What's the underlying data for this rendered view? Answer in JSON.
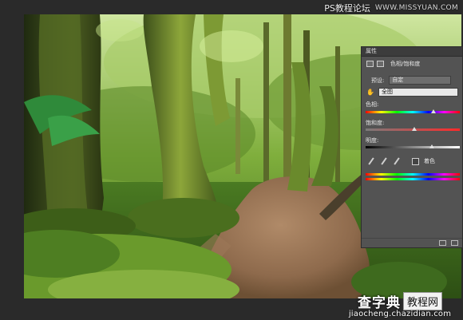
{
  "watermark_top": {
    "title": "PS教程论坛",
    "site": "WWW.MISSYUAN.COM"
  },
  "watermark_bottom": {
    "brand": "查字典",
    "box_text": "教程网",
    "url": "jiaocheng.chazidian.com"
  },
  "panel": {
    "title": "属性",
    "adjustment_name": "色相/饱和度",
    "preset_label": "预设:",
    "preset_value": "自定",
    "channel_value": "全图",
    "hue_label": "色相:",
    "saturation_label": "饱和度:",
    "lightness_label": "明度:",
    "colorize_label": "着色",
    "hue_value_fraction": 0.72,
    "saturation_value_fraction": 0.52,
    "lightness_value_fraction": 0.7
  },
  "colors": {
    "panel_bg": "#535353",
    "workspace_bg": "#2a2a2a"
  }
}
